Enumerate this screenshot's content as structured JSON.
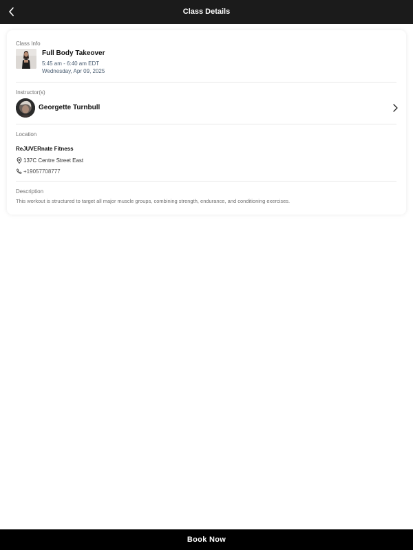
{
  "header": {
    "title": "Class Details",
    "back_icon": "chevron-left-icon"
  },
  "class_info": {
    "label": "Class Info",
    "title": "Full Body Takeover",
    "time": "5:45 am - 6:40 am EDT",
    "date": "Wednesday, Apr 09, 2025"
  },
  "instructors": {
    "label": "Instructor(s)",
    "items": [
      {
        "name": "Georgette Turnbull"
      }
    ]
  },
  "location": {
    "label": "Location",
    "name": "ReJUVERnate Fitness",
    "address": "137C Centre Street East",
    "phone": "+19057708777",
    "address_icon": "map-pin-icon",
    "phone_icon": "phone-icon"
  },
  "description": {
    "label": "Description",
    "text": "This workout is structured to target all major muscle groups, combining strength, endurance, and conditioning exercises."
  },
  "footer": {
    "book_label": "Book Now"
  },
  "colors": {
    "topbar": "#1b1b1b",
    "book_bar": "#000000",
    "subtext": "#4b5e72",
    "label": "#6f6f6f"
  }
}
